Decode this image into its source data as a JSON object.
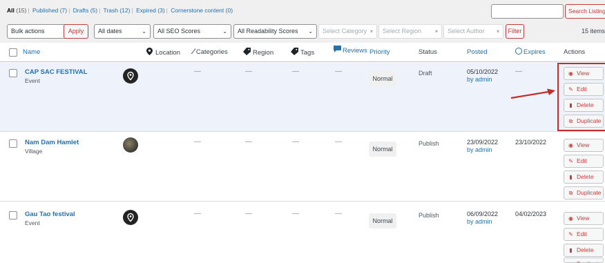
{
  "views": [
    {
      "label": "All",
      "count": "(15)"
    },
    {
      "label": "Published",
      "count": "(7)"
    },
    {
      "label": "Drafts",
      "count": "(5)"
    },
    {
      "label": "Trash",
      "count": "(12)"
    },
    {
      "label": "Expired",
      "count": "(3)"
    },
    {
      "label": "Cornerstone content",
      "count": "(0)"
    }
  ],
  "search": {
    "value": "",
    "button": "Search Listings"
  },
  "filters": {
    "bulk_actions": "Bulk actions",
    "apply": "Apply",
    "dates": "All dates",
    "seo": "All SEO Scores",
    "readability": "All Readability Scores",
    "category": "Select Category",
    "region": "Select Region",
    "author": "Select Author",
    "filter_button": "Filter",
    "items_count": "15 items"
  },
  "columns": {
    "name": "Name",
    "location": "Location",
    "categories": "Categories",
    "region": "Region",
    "tags": "Tags",
    "reviews": "Reviews",
    "priority": "Priority",
    "status": "Status",
    "posted": "Posted",
    "expires": "Expires",
    "actions": "Actions"
  },
  "rows": [
    {
      "title": "CAP SAC FESTIVAL",
      "type": "Event",
      "categories": "—",
      "region": "—",
      "tags": "—",
      "reviews": "—",
      "priority": "Normal",
      "status": "Draft",
      "posted_date": "05/10/2022",
      "posted_by": "by admin",
      "expires": "—"
    },
    {
      "title": "Nam Dam Hamlet",
      "type": "Village",
      "categories": "—",
      "region": "—",
      "tags": "—",
      "reviews": "—",
      "priority": "Normal",
      "status": "Publish",
      "posted_date": "23/09/2022",
      "posted_by": "by admin",
      "expires": "23/10/2022"
    },
    {
      "title": "Gau Tao festival",
      "type": "Event",
      "categories": "—",
      "region": "—",
      "tags": "—",
      "reviews": "—",
      "priority": "Normal",
      "status": "Publish",
      "posted_date": "06/09/2022",
      "posted_by": "by admin",
      "expires": "04/02/2023"
    }
  ],
  "actions": {
    "view": "View",
    "edit": "Edit",
    "delete": "Delete",
    "duplicate": "Duplicate"
  },
  "colors": {
    "accent": "#2271b1",
    "danger": "#c83a3a",
    "highlight": "#c42b2b",
    "row_selected": "#eef2fb"
  }
}
